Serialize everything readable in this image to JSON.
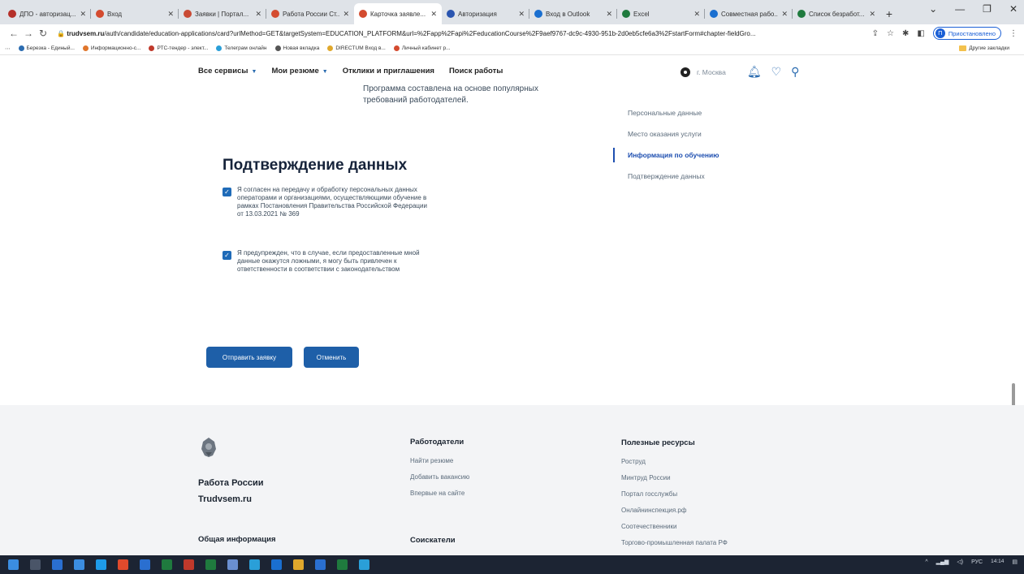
{
  "browser": {
    "tabs": [
      {
        "label": "ДПО - авторизац...",
        "color": "#b5302a",
        "active": false
      },
      {
        "label": "Вход",
        "color": "#d44b2f",
        "active": false
      },
      {
        "label": "Заявки | Портал...",
        "color": "#c94a34",
        "active": false
      },
      {
        "label": "Работа России Ст...",
        "color": "#d44b2f",
        "active": false
      },
      {
        "label": "Карточка заявле...",
        "color": "#d44b2f",
        "active": true
      },
      {
        "label": "Авторизация",
        "color": "#2a55b0",
        "active": false
      },
      {
        "label": "Вход в Outlook",
        "color": "#1a6fd0",
        "active": false
      },
      {
        "label": "Excel",
        "color": "#1f7a3e",
        "active": false
      },
      {
        "label": "Совместная рабо...",
        "color": "#1a6fd0",
        "active": false
      },
      {
        "label": "Список безработ...",
        "color": "#1f7a3e",
        "active": false
      }
    ],
    "url_domain": "trudvsem.ru",
    "url_rest": "/auth/candidate/education-applications/card?urlMethod=GET&targetSystem=EDUCATION_PLATFORM&url=%2Fapp%2Fapi%2FeducationCourse%2F9aef9767-dc9c-4930-951b-2d0eb5cfe6a3%2FstartForm#chapter-fieldGro...",
    "profile_initial": "П",
    "profile_label": "Приостановлено",
    "bookmarks": [
      {
        "label": "Березка - Единый...",
        "color": "#2b6cb0"
      },
      {
        "label": "Информационно-с...",
        "color": "#e0762c"
      },
      {
        "label": "РТС-тендер - элект...",
        "color": "#c0392b"
      },
      {
        "label": "Телеграм онлайн",
        "color": "#2a9fd8"
      },
      {
        "label": "Новая вкладка",
        "color": "#555555"
      },
      {
        "label": "DIRECTUM Вход в...",
        "color": "#e0a82c"
      },
      {
        "label": "Личный кабинет р...",
        "color": "#d44b2f"
      }
    ],
    "other_bookmarks": "Другие закладки"
  },
  "header": {
    "nav": [
      "Все сервисы",
      "Мои резюме",
      "Отклики и приглашения",
      "Поиск работы"
    ],
    "city": "г. Москва"
  },
  "content": {
    "program_text": "Программа составлена на основе популярных требований работодателей.",
    "side_menu": [
      {
        "label": "Персональные данные",
        "active": false
      },
      {
        "label": "Место оказания услуги",
        "active": false
      },
      {
        "label": "Информация по обучению",
        "active": true
      },
      {
        "label": "Подтверждение данных",
        "active": false
      }
    ],
    "confirm_title": "Подтверждение данных",
    "consent_1": "Я согласен на передачу и обработку персональных данных операторами и организациями, осуществляющими обучение в рамках Постановления Правительства Российской Федерации от 13.03.2021 № 369",
    "consent_2": "Я предупрежден, что в случае, если предоставленные мной данные окажутся ложными, я могу быть привлечен к ответственности в соответствии с законодательством",
    "submit_label": "Отправить заявку",
    "cancel_label": "Отменить"
  },
  "footer": {
    "brand_line1": "Работа России",
    "brand_line2": "Trudvsem.ru",
    "general_heading": "Общая информация",
    "employers_heading": "Работодатели",
    "employers_links": [
      "Найти резюме",
      "Добавить вакансию",
      "Впервые на сайте"
    ],
    "seekers_heading": "Соискатели",
    "resources_heading": "Полезные ресурсы",
    "resources_links": [
      "Роструд",
      "Минтруд России",
      "Портал госслужбы",
      "Онлайнинспекция.рф",
      "Соотечественники",
      "Торгово-промышленная палата РФ"
    ]
  },
  "taskbar": {
    "icons": [
      "#2a6fd0",
      "#3b8de0",
      "#1e9be8",
      "#e04a2c",
      "#2a6fd0",
      "#1f7a3e",
      "#c0392b",
      "#1f7a3e",
      "#6a8fd0",
      "#2a9fd8",
      "#1a6fd0",
      "#e0a82c",
      "#2a6fd0",
      "#1f7a3e",
      "#2a9fd8"
    ],
    "lang": "РУС",
    "time": "14:14"
  }
}
